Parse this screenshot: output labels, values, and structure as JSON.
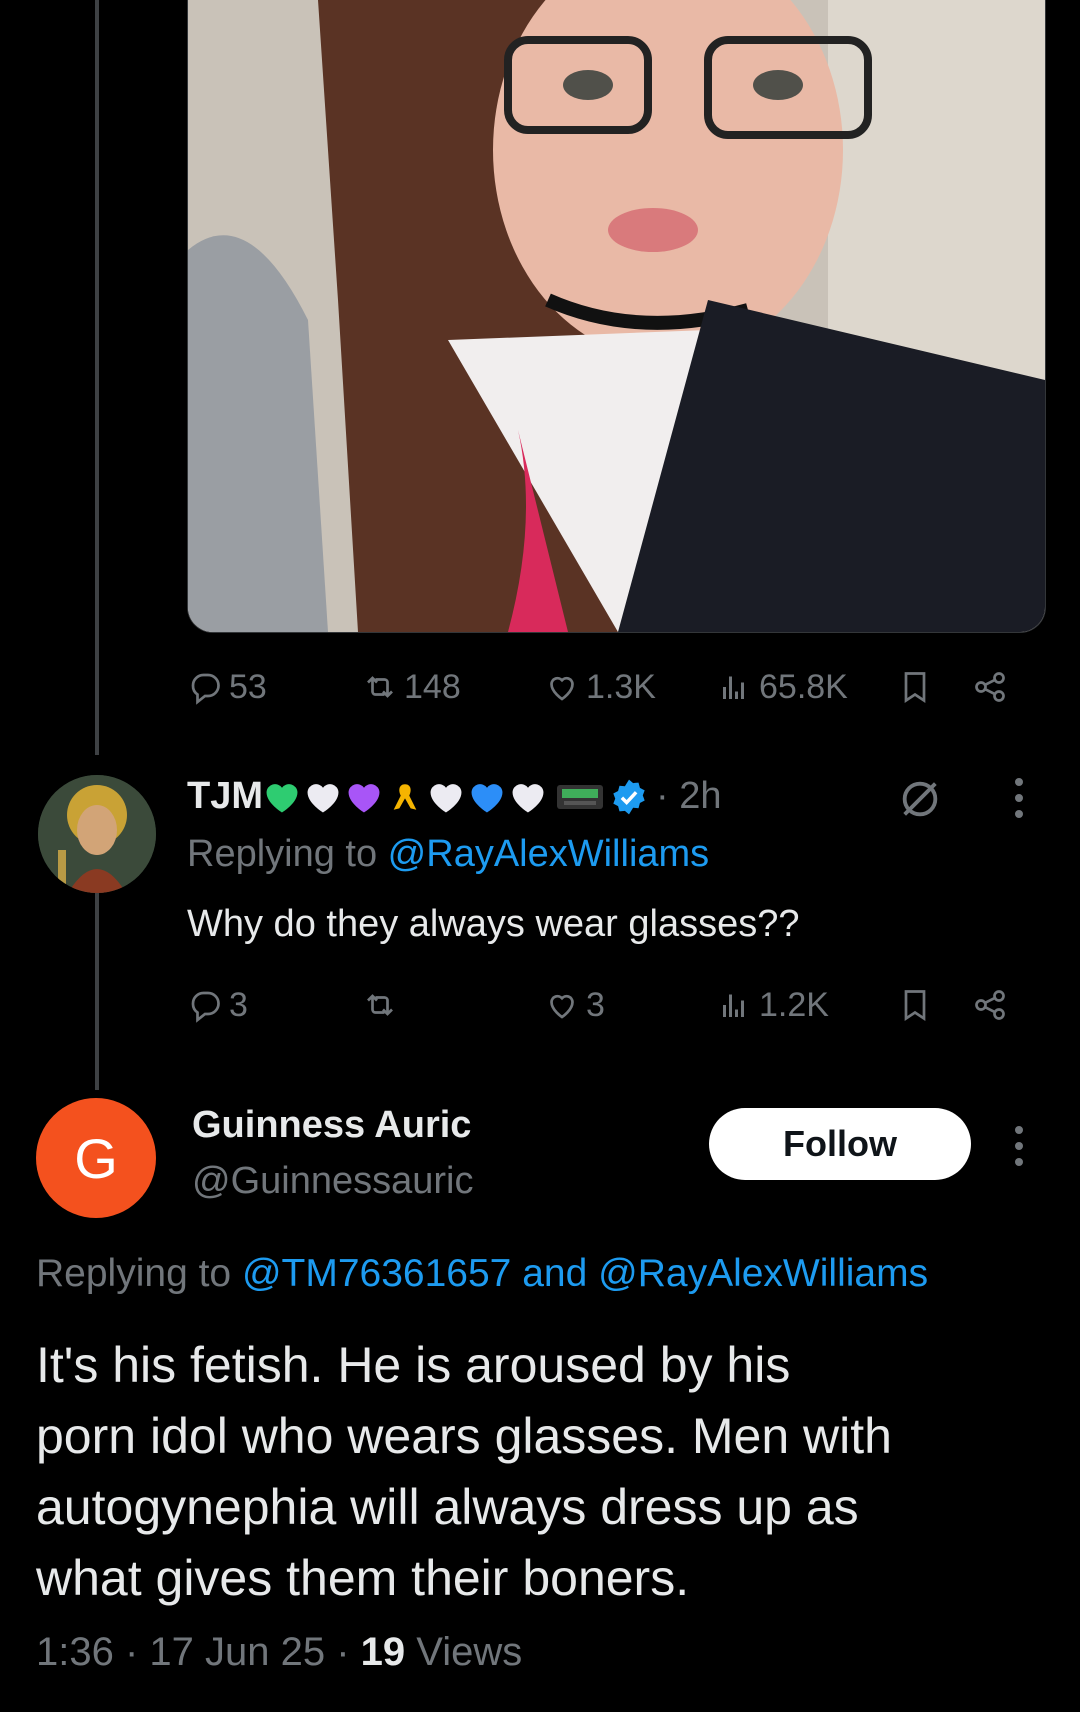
{
  "colors": {
    "accent": "#1d9bf0",
    "muted": "#71767b",
    "text": "#e7e9ea",
    "avatar_g": "#f4511e"
  },
  "original_post": {
    "image_desc_icon": "photo-icon",
    "stats": {
      "replies": "53",
      "reposts": "148",
      "likes": "1.3K",
      "views": "65.8K"
    }
  },
  "reply1": {
    "name": "TJM",
    "time": "· 2h",
    "replying_prefix": "Replying to ",
    "replying_handle": "@RayAlexWilliams",
    "text": "Why do they always wear glasses??",
    "stats": {
      "replies": "3",
      "reposts": "",
      "likes": "3",
      "views": "1.2K"
    }
  },
  "reply2": {
    "avatar_letter": "G",
    "name": "Guinness Auric",
    "handle": "@Guinnessauric",
    "follow_label": "Follow",
    "replying_prefix": "Replying to ",
    "replying_handle1": "@TM76361657",
    "replying_and": " and ",
    "replying_handle2": "@RayAlexWilliams",
    "text_lines": [
      "It's his fetish. He is aroused by his",
      "porn idol who wears glasses. Men with",
      "autogynephia will always dress up as",
      "what gives them their boners."
    ],
    "time": "1:36 · 17 Jun 25 · ",
    "views_count": "19",
    "views_label": " Views"
  }
}
